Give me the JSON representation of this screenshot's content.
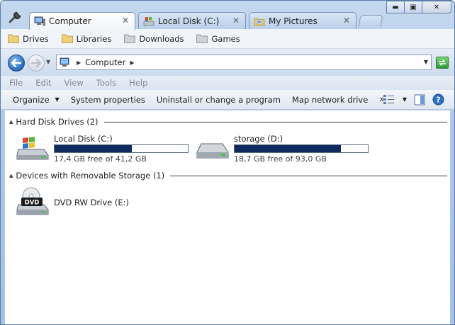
{
  "tabs": [
    {
      "label": "Computer",
      "close": "✕",
      "icon": "computer-icon",
      "active": true
    },
    {
      "label": "Local Disk (C:)",
      "close": "✕",
      "icon": "windows-drive-icon",
      "active": false
    },
    {
      "label": "My Pictures",
      "close": "✕",
      "icon": "pictures-folder-icon",
      "active": false
    }
  ],
  "window_buttons": {
    "minimize": "▬",
    "maximize": "▣",
    "close": "✕"
  },
  "favorites": [
    "Drives",
    "Libraries",
    "Downloads",
    "Games"
  ],
  "address": {
    "crumb": "Computer"
  },
  "menu": [
    "File",
    "Edit",
    "View",
    "Tools",
    "Help"
  ],
  "commands": {
    "organize": "Organize",
    "system_properties": "System properties",
    "uninstall": "Uninstall or change a program",
    "map_drive": "Map network drive",
    "more": "»"
  },
  "groups": {
    "hdd": {
      "title": "Hard Disk Drives (2)"
    },
    "removable": {
      "title": "Devices with Removable Storage (1)"
    }
  },
  "drives": [
    {
      "name": "Local Disk (C:)",
      "free_text": "17,4 GB free of 41,2 GB",
      "used_fraction": 0.58,
      "icon": "windows-drive-icon"
    },
    {
      "name": "storage (D:)",
      "free_text": "18,7 GB free of 93,0 GB",
      "used_fraction": 0.8,
      "icon": "hard-drive-icon"
    }
  ],
  "dvd": {
    "name": "DVD RW Drive (E:)",
    "badge": "DVD",
    "icon": "dvd-drive-icon"
  },
  "colors": {
    "usage_bar": "#0e2a5e",
    "accent": "#2b6fc2"
  }
}
